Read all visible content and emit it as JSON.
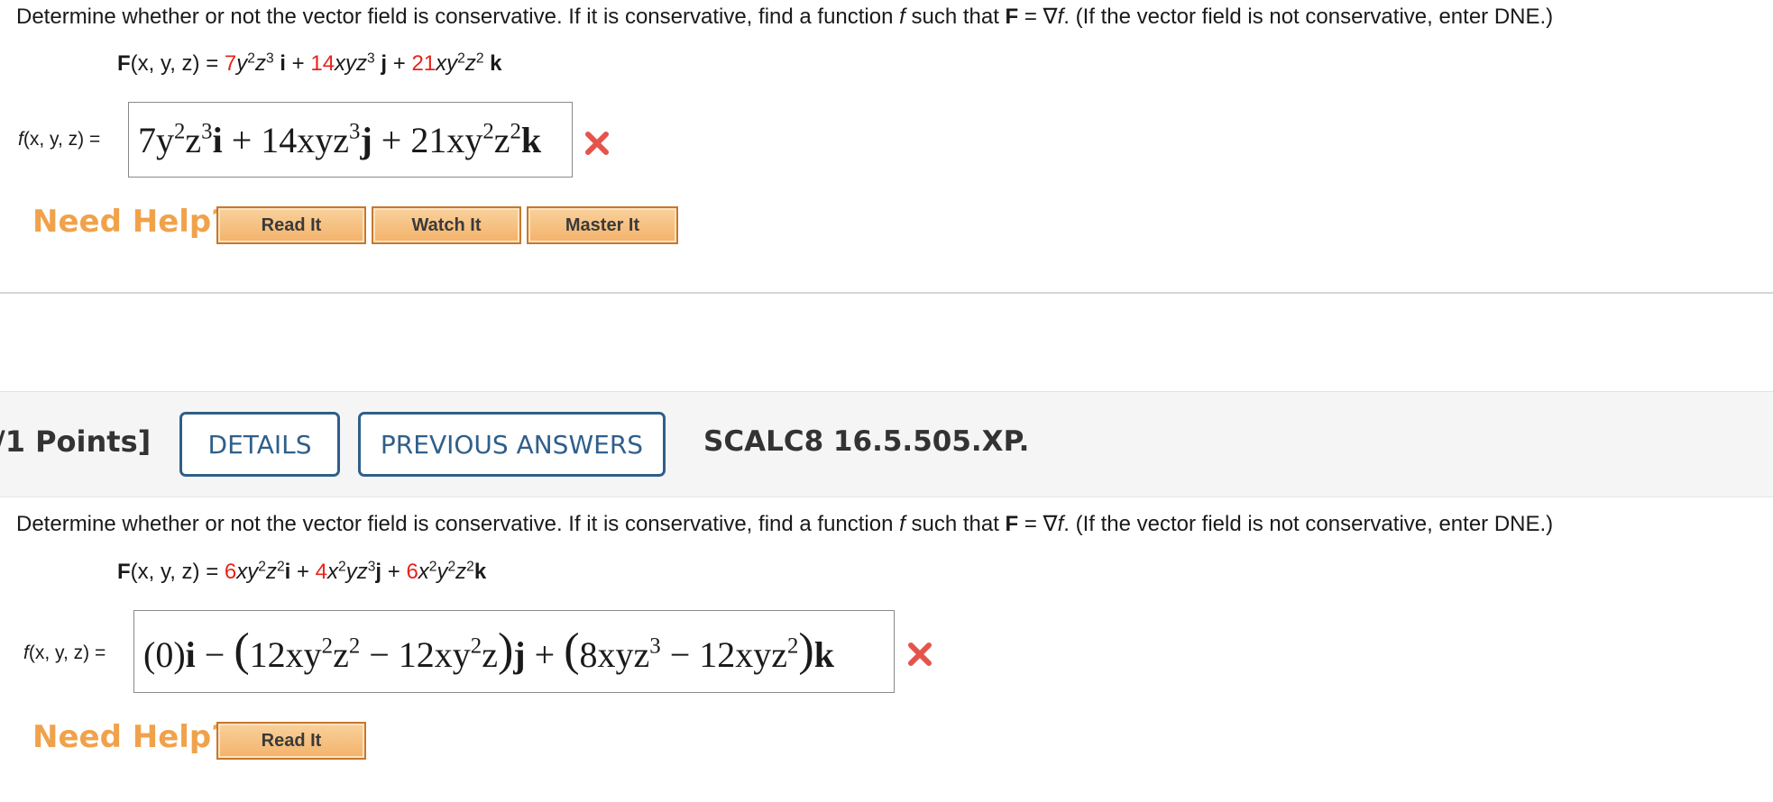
{
  "q1": {
    "prompt_a": "Determine whether or not the vector field is conservative. If it is conservative, find a function ",
    "prompt_f": "f",
    "prompt_b": " such that ",
    "prompt_F": "F",
    "prompt_c": " = ∇",
    "prompt_f2": "f",
    "prompt_d": ". (If the vector field is not conservative, enter DNE.)",
    "formula": {
      "F": "F",
      "args": "(x, y, z) = ",
      "c1": "7",
      "t1": "y",
      "e1": "2",
      "t1b": "z",
      "e1b": "3",
      "u1": " i",
      "p1": " + ",
      "c2": "14",
      "t2": "xyz",
      "e2": "3",
      "u2": " j",
      "p2": " + ",
      "c3": "21",
      "t3": "xy",
      "e3": "2",
      "t3b": "z",
      "e3b": "2",
      "u3": " k"
    },
    "f_label_f": "f",
    "f_label_rest": "(x, y, z) =",
    "answer": {
      "a1": "7y",
      "s1": "2",
      "a2": "z",
      "s2": "3",
      "a3": "i",
      "op1": " + ",
      "a4": "14xyz",
      "s3": "3",
      "a5": "j",
      "op2": " + ",
      "a6": "21xy",
      "s4": "2",
      "a7": "z",
      "s5": "2",
      "a8": "k"
    },
    "help_label": "Need Help?",
    "btn_read": "Read It",
    "btn_watch": "Watch It",
    "btn_master": "Master It"
  },
  "band": {
    "points": "/1 Points]",
    "details": "DETAILS",
    "previous": "PREVIOUS ANSWERS",
    "code": "SCALC8 16.5.505.XP."
  },
  "q2": {
    "prompt_a": "Determine whether or not the vector field is conservative. If it is conservative, find a function ",
    "prompt_f": "f",
    "prompt_b": " such that ",
    "prompt_F": "F",
    "prompt_c": " = ∇",
    "prompt_f2": "f",
    "prompt_d": ". (If the vector field is not conservative, enter DNE.)",
    "formula": {
      "F": "F",
      "args": "(x, y, z) = ",
      "c1": "6",
      "t1": "xy",
      "e1": "2",
      "t1b": "z",
      "e1b": "2",
      "u1": "i",
      "p1": " + ",
      "c2": "4",
      "t2": "x",
      "e2": "2",
      "t2b": "yz",
      "e2b": "3",
      "u2": "j",
      "p2": " + ",
      "c3": "6",
      "t3": "x",
      "e3": "2",
      "t3b": "y",
      "e3b": "2",
      "t3c": "z",
      "e3c": "2",
      "u3": "k"
    },
    "f_label_f": "f",
    "f_label_rest": "(x, y, z) =",
    "answer": {
      "p0": "(0)",
      "i": "i",
      "m1": " − ",
      "lp1": "(",
      "b1": "12xy",
      "s1": "2",
      "b2": "z",
      "s2": "2",
      "m2": " − ",
      "b3": "12xy",
      "s3": "2",
      "b4": "z",
      "rp1": ")",
      "j": "j",
      "pl": " + ",
      "lp2": "(",
      "c1": "8xyz",
      "s4": "3",
      "m3": " − ",
      "c2": "12xyz",
      "s5": "2",
      "rp2": ")",
      "k": "k"
    },
    "help_label": "Need Help?",
    "btn_read": "Read It"
  },
  "colors": {
    "coef_red": "#e8231b",
    "wrong_x": "#e4544c",
    "help_orange": "#f0a24b",
    "band_blue": "#2f5f8a"
  },
  "icons": {
    "incorrect": "x-mark-icon"
  }
}
